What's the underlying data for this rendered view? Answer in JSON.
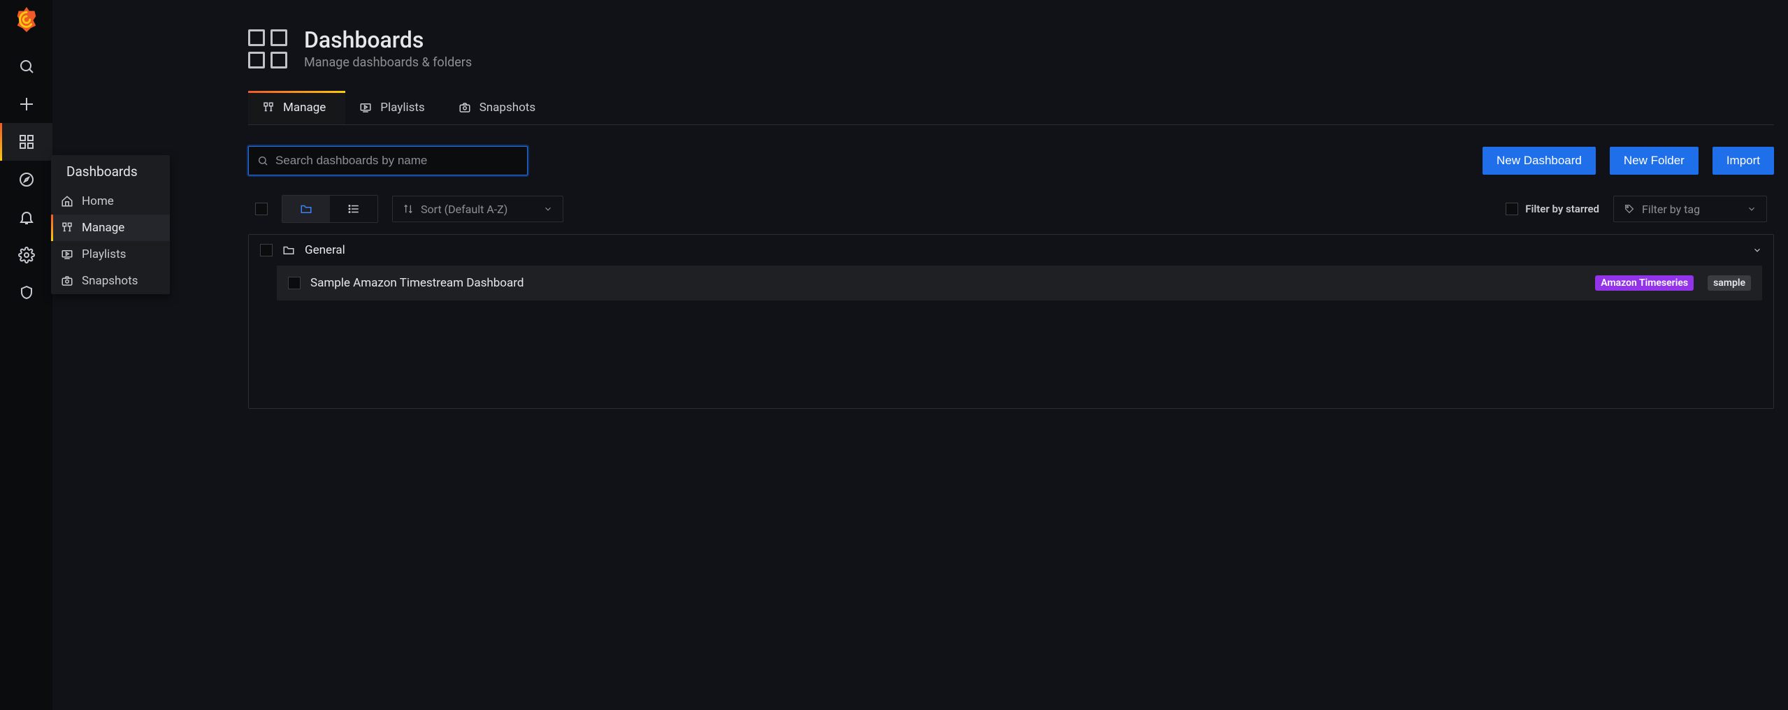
{
  "rail": {
    "items": [
      {
        "name": "search-icon"
      },
      {
        "name": "plus-icon"
      },
      {
        "name": "dashboards-icon",
        "active": true
      },
      {
        "name": "explore-icon"
      },
      {
        "name": "alert-icon"
      },
      {
        "name": "gear-icon"
      },
      {
        "name": "shield-icon"
      }
    ]
  },
  "flyout": {
    "title": "Dashboards",
    "items": [
      {
        "label": "Home"
      },
      {
        "label": "Manage",
        "active": true
      },
      {
        "label": "Playlists"
      },
      {
        "label": "Snapshots"
      }
    ]
  },
  "page": {
    "title": "Dashboards",
    "subtitle": "Manage dashboards & folders"
  },
  "tabs": [
    {
      "label": "Manage",
      "active": true
    },
    {
      "label": "Playlists"
    },
    {
      "label": "Snapshots"
    }
  ],
  "search": {
    "placeholder": "Search dashboards by name"
  },
  "buttons": {
    "new_dashboard": "New Dashboard",
    "new_folder": "New Folder",
    "import": "Import"
  },
  "filters": {
    "sort_label": "Sort (Default A-Z)",
    "starred_label": "Filter by starred",
    "tag_label": "Filter by tag"
  },
  "folders": [
    {
      "name": "General",
      "items": [
        {
          "name": "Sample Amazon Timestream Dashboard",
          "tags": [
            {
              "label": "Amazon Timeseries",
              "class": "purple"
            },
            {
              "label": "sample",
              "class": "gray"
            }
          ]
        }
      ]
    }
  ]
}
